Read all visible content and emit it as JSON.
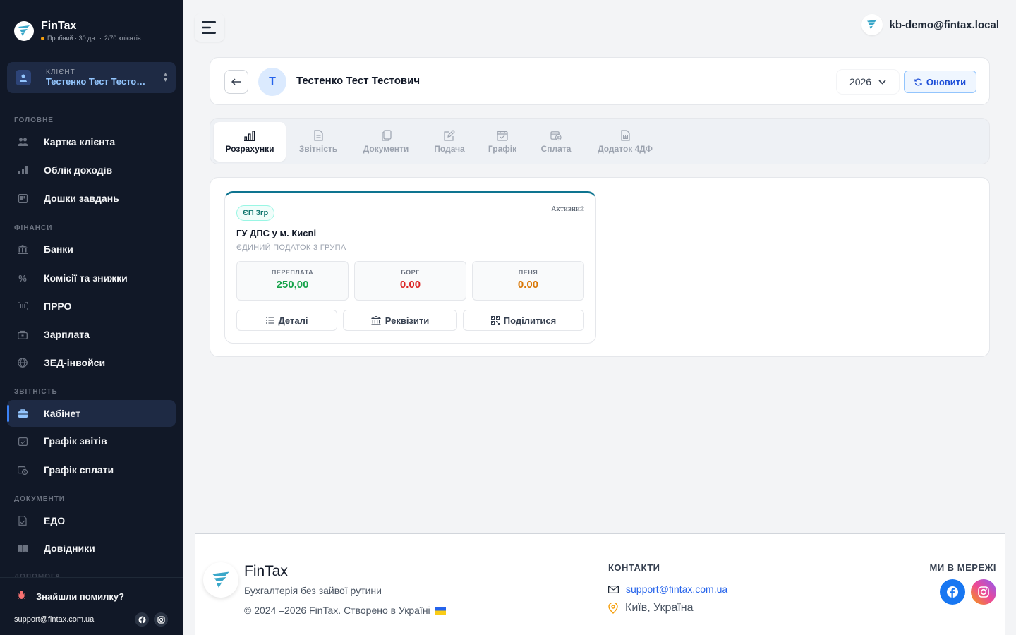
{
  "brand": {
    "name": "FinTax",
    "trial": "Пробний · 30 дн.",
    "sep": "·",
    "clients": "2/70 клієнтів"
  },
  "client_selector": {
    "label": "КЛІЄНТ",
    "name": "Тестенко Тест Тестович"
  },
  "sidebar": {
    "sections": {
      "main": "ГОЛОВНЕ",
      "finance": "ФІНАНСИ",
      "reports": "ЗВІТНІСТЬ",
      "documents": "ДОКУМЕНТИ",
      "help": "ДОПОМОГА"
    },
    "items": [
      {
        "label": "Картка клієнта",
        "icon": "users-icon"
      },
      {
        "label": "Облік доходів",
        "icon": "bar-chart-icon"
      },
      {
        "label": "Дошки завдань",
        "icon": "board-icon"
      },
      {
        "label": "Банки",
        "icon": "bank-icon"
      },
      {
        "label": "Комісії та знижки",
        "icon": "percent-icon"
      },
      {
        "label": "ПРРО",
        "icon": "barcode-icon"
      },
      {
        "label": "Зарплата",
        "icon": "wallet-icon"
      },
      {
        "label": "ЗЕД-інвойси",
        "icon": "globe-icon"
      },
      {
        "label": "Кабінет",
        "icon": "briefcase-icon",
        "active": true
      },
      {
        "label": "Графік звітів",
        "icon": "calendar-check-icon"
      },
      {
        "label": "Графік сплати",
        "icon": "calendar-money-icon"
      },
      {
        "label": "ЕДО",
        "icon": "doc-sign-icon"
      },
      {
        "label": "Довідники",
        "icon": "book-icon"
      }
    ],
    "bug_report": "Знайшли помилку?",
    "support_email": "support@fintax.com.ua"
  },
  "user": {
    "email": "kb-demo@fintax.local"
  },
  "header": {
    "avatar_letter": "Т",
    "client_name": "Тестенко Тест Тестович",
    "year": "2026",
    "refresh_label": "Оновити"
  },
  "tabs": [
    {
      "label": "Розрахунки",
      "icon": "bar-chart-icon",
      "active": true
    },
    {
      "label": "Звітність",
      "icon": "document-icon"
    },
    {
      "label": "Документи",
      "icon": "copy-icon"
    },
    {
      "label": "Подача",
      "icon": "edit-icon"
    },
    {
      "label": "Графік",
      "icon": "calendar-icon"
    },
    {
      "label": "Сплата",
      "icon": "payment-icon"
    },
    {
      "label": "Додаток 4ДФ",
      "icon": "sheet-icon"
    }
  ],
  "tax_card": {
    "badge": "ЄП 3гр",
    "status": "Активний",
    "title": "ГУ ДПС у м. Києві",
    "subtitle": "ЄДИНИЙ ПОДАТОК 3 ГРУПА",
    "metrics": [
      {
        "label": "ПЕРЕПЛАТА",
        "value": "250,00",
        "color": "#16a34a"
      },
      {
        "label": "БОРГ",
        "value": "0.00",
        "color": "#dc2626"
      },
      {
        "label": "ПЕНЯ",
        "value": "0.00",
        "color": "#d97706"
      }
    ],
    "actions": {
      "details": "Деталі",
      "requisites": "Реквізити",
      "share": "Поділитися"
    }
  },
  "footer": {
    "brand": "FinTax",
    "tagline": "Бухгалтерія без зайвої рутини",
    "copyright": "© 2024 –2026 FinTax. Створено в Україні",
    "contacts_title": "КОНТАКТИ",
    "email": "support@fintax.com.ua",
    "city": "Київ, Україна",
    "social_title": "МИ В МЕРЕЖІ"
  },
  "colors": {
    "sidebar_bg": "#111827",
    "accent": "#3b82f6",
    "teal": "#0e7490",
    "facebook": "#1877f2"
  }
}
